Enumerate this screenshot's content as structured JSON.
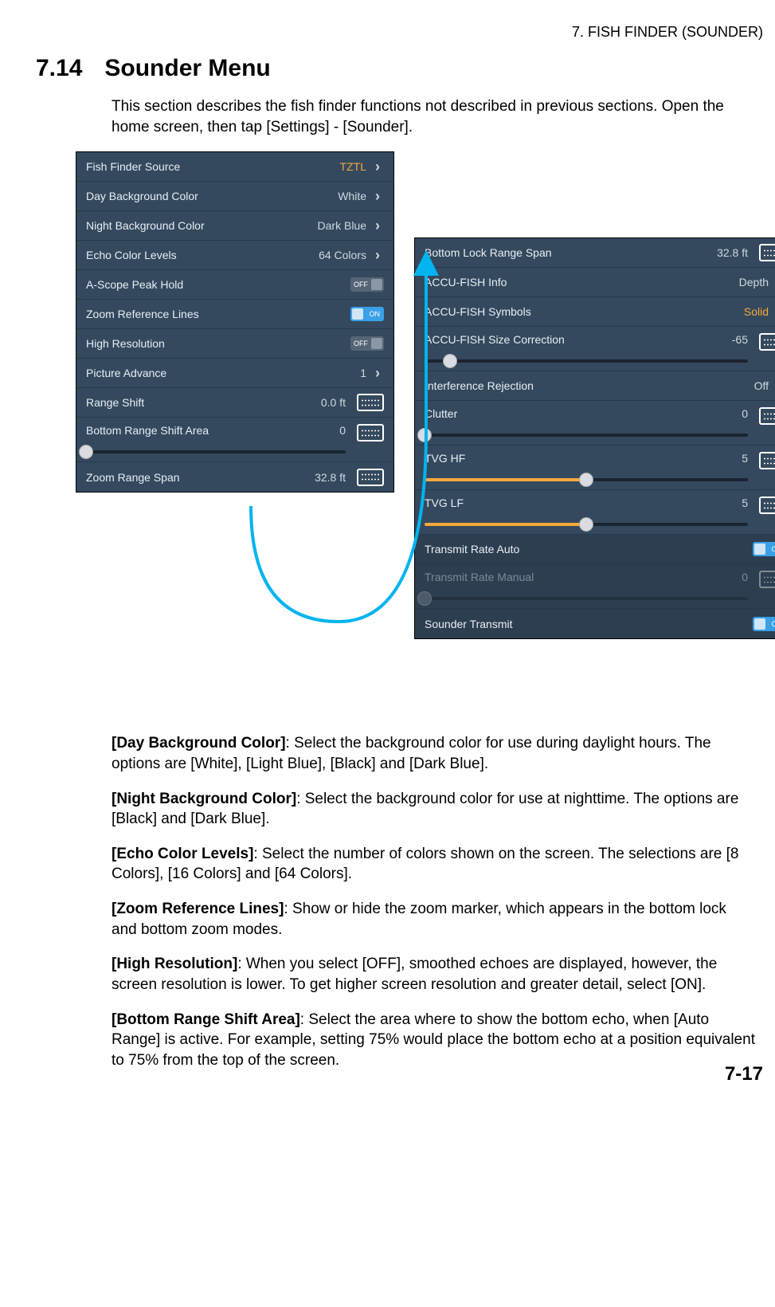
{
  "header": "7.  FISH FINDER (SOUNDER)",
  "section": {
    "num": "7.14",
    "title": "Sounder Menu"
  },
  "intro": "This section describes the fish finder functions not described in previous sections. Open the home screen, then tap [Settings] - [Sounder].",
  "left_panel": {
    "r1": {
      "label": "Fish Finder Source",
      "value": "TZTL"
    },
    "r2": {
      "label": "Day Background Color",
      "value": "White"
    },
    "r3": {
      "label": "Night Background Color",
      "value": "Dark Blue"
    },
    "r4": {
      "label": "Echo Color Levels",
      "value": "64 Colors"
    },
    "r5": {
      "label": "A-Scope Peak Hold",
      "toggle": "OFF"
    },
    "r6": {
      "label": "Zoom Reference Lines",
      "toggle": "ON"
    },
    "r7": {
      "label": "High Resolution",
      "toggle": "OFF"
    },
    "r8": {
      "label": "Picture Advance",
      "value": "1"
    },
    "r9": {
      "label": "Range Shift",
      "value": "0.0 ft"
    },
    "r10": {
      "label": "Bottom Range Shift Area",
      "value": "0"
    },
    "r11": {
      "label": "Zoom Range Span",
      "value": "32.8 ft"
    }
  },
  "right_panel": {
    "r1": {
      "label": "Bottom Lock Range Span",
      "value": "32.8 ft"
    },
    "r2": {
      "label": "ACCU-FISH Info",
      "value": "Depth"
    },
    "r3": {
      "label": "ACCU-FISH Symbols",
      "value": "Solid"
    },
    "r4": {
      "label": "ACCU-FISH Size Correction",
      "value": "-65"
    },
    "r5": {
      "label": "Interference Rejection",
      "value": "Off"
    },
    "r6": {
      "label": "Clutter",
      "value": "0"
    },
    "r7": {
      "label": "TVG HF",
      "value": "5"
    },
    "r8": {
      "label": "TVG LF",
      "value": "5"
    },
    "r9": {
      "label": "Transmit Rate Auto",
      "toggle": "ON"
    },
    "r10": {
      "label": "Transmit Rate Manual",
      "value": "0"
    },
    "r11": {
      "label": "Sounder Transmit",
      "toggle": "ON"
    }
  },
  "desc": {
    "p1b": "[Day Background Color]",
    "p1": ": Select the background color for use during daylight hours. The options are [White], [Light Blue], [Black] and [Dark Blue].",
    "p2b": "[Night Background Color]",
    "p2": ": Select the background color for use at nighttime. The options are [Black] and [Dark Blue].",
    "p3b": "[Echo Color Levels]",
    "p3": ": Select the number of colors shown on the screen. The selections are [8 Colors], [16 Colors] and [64 Colors].",
    "p4b": "[Zoom Reference Lines]",
    "p4": ": Show or hide the zoom marker, which appears in the bottom lock and bottom zoom modes.",
    "p5b": "[High Resolution]",
    "p5": ": When you select [OFF], smoothed echoes are displayed, however, the screen resolution is lower. To get higher screen resolution and greater detail, select [ON].",
    "p6b": "[Bottom Range Shift Area]",
    "p6": ": Select the area where to show the bottom echo, when [Auto Range] is active. For example, setting 75% would place the bottom echo at a position equivalent to 75% from the top of the screen."
  },
  "page_num": "7-17"
}
